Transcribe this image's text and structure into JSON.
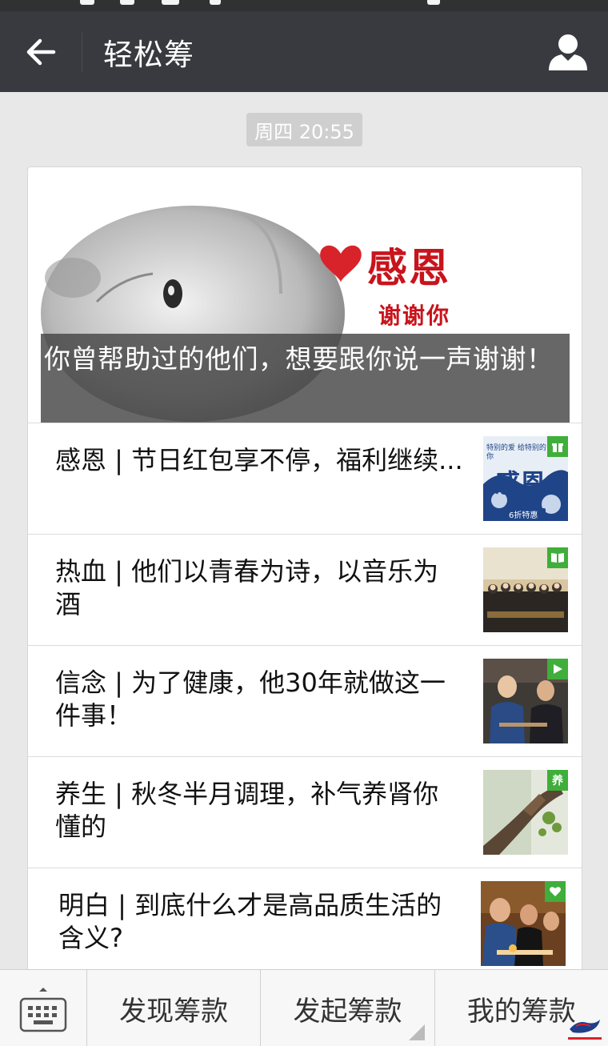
{
  "header": {
    "title": "轻松筹"
  },
  "chat": {
    "timestamp": "周四 20:55"
  },
  "hero": {
    "heading": "感恩",
    "subheading": "谢谢你",
    "caption": "你曾帮助过的他们，想要跟你说一声谢谢！"
  },
  "articles": [
    {
      "title": "感恩 | 节日红包享不停，福利继续...",
      "tag_icon": "gift-icon",
      "thumb_text": "感恩",
      "thumb_badge": "6折特惠",
      "thumb_top": "特别的爱 给特别的你"
    },
    {
      "title": "热血 | 他们以青春为诗，以音乐为酒",
      "tag_icon": "book-icon"
    },
    {
      "title": "信念 | 为了健康，他30年就做这一件事！",
      "tag_icon": "play-icon"
    },
    {
      "title": "养生 | 秋冬半月调理，补气养肾你懂的",
      "tag_icon": "health-icon",
      "tag_text": "养"
    },
    {
      "title": "明白 | 到底什么才是高品质生活的含义?",
      "tag_icon": "heart-icon"
    }
  ],
  "bottom_bar": {
    "menu": [
      "发现筹款",
      "发起筹款",
      "我的筹款"
    ]
  },
  "colors": {
    "header_bg": "#393a3f",
    "tag_green": "#3fae3a",
    "heart_red": "#d8232a"
  }
}
